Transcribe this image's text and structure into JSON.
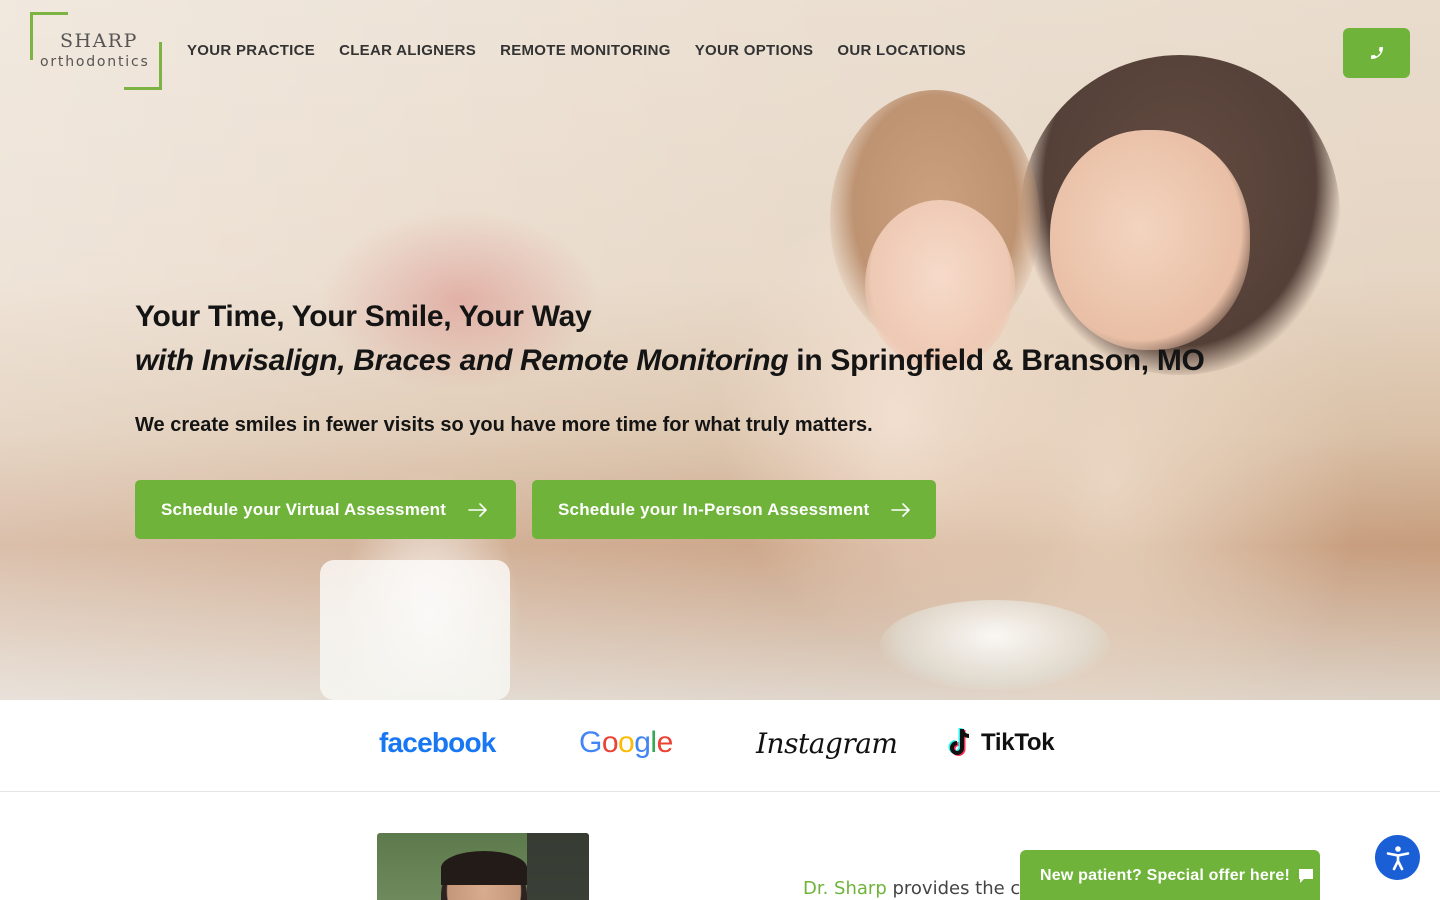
{
  "brand": {
    "logo_line1": "SHARP",
    "logo_line2": "orthodontics",
    "accent_color": "#6fb33a"
  },
  "nav": {
    "items": [
      {
        "label": "YOUR PRACTICE"
      },
      {
        "label": "CLEAR ALIGNERS"
      },
      {
        "label": "REMOTE MONITORING"
      },
      {
        "label": "YOUR OPTIONS"
      },
      {
        "label": "OUR LOCATIONS"
      }
    ],
    "phone_icon": "phone-icon"
  },
  "hero": {
    "headline_line1": "Your Time, Your Smile, Your Way",
    "headline_line2_italic": "with Invisalign, Braces and Remote Monitoring",
    "headline_line2_rest": " in Springfield & Branson, MO",
    "subheadline": "We create smiles in fewer visits so you have more time for what truly matters.",
    "cta_virtual": "Schedule your Virtual Assessment",
    "cta_in_person": "Schedule your In-Person Assessment",
    "cta_icon": "arrow-right-icon"
  },
  "social": {
    "facebook": "facebook",
    "google": [
      "G",
      "o",
      "o",
      "g",
      "l",
      "e"
    ],
    "instagram": "Instagram",
    "tiktok": "TikTok"
  },
  "intro": {
    "doctor_name": "Dr. Sharp",
    "text_visible": " provides the c"
  },
  "offer": {
    "label": "New patient? Special offer here!",
    "icon": "chat-bubble-icon"
  },
  "accessibility": {
    "icon": "accessibility-icon",
    "color": "#1a5fd6"
  }
}
